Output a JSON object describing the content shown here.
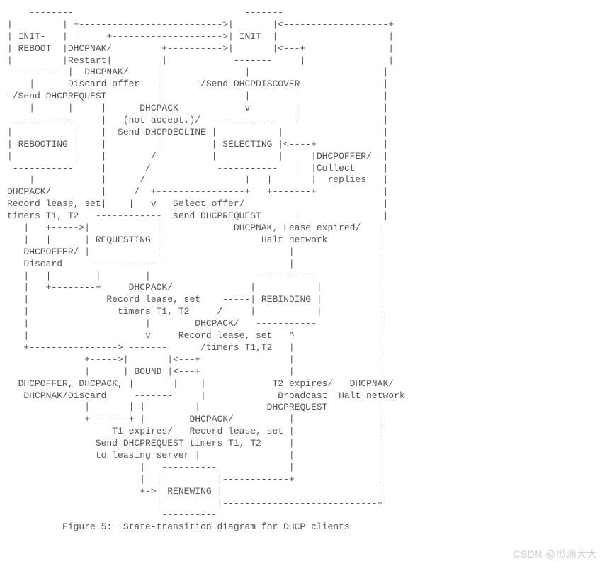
{
  "diagram": {
    "ascii": "    --------                               -------\n|         | +-------------------------->|       |<-------------------+\n| INIT-   | |     +-------------------->| INIT  |                    |\n| REBOOT  |DHCPNAK/         +---------->|       |<---+               |\n|         |Restart|         |            -------     |               |\n --------  |  DHCPNAK/     |               |                        |\n    |      Discard offer   |      -/Send DHCPDISCOVER               |\n-/Send DHCPREQUEST         |               |                        |\n    |      |     |      DHCPACK            v        |               |\n -----------     |   (not accept.)/   -----------   |               |\n|           |    |  Send DHCPDECLINE |           |                  |\n| REBOOTING |    |         |         | SELECTING |<----+            |\n|           |    |        /          |           |     |DHCPOFFER/  |\n -----------     |       /            -----------   |  |Collect     |\n    |            |      /                  |   |       |  replies   |\nDHCPACK/         |     /  +----------------+   +-------+            |\nRecord lease, set|    |   v   Select offer/                         |\ntimers T1, T2   ------------  send DHCPREQUEST      |               |\n   |   +----->|            |             DHCPNAK, Lease expired/   |\n   |   |      | REQUESTING |                  Halt network         |\n   DHCPOFFER/ |            |                       |               |\n   Discard     ------------                        |               |\n   |   |        |        |                   -----------           |\n   |   +--------+     DHCPACK/              |           |          |\n   |              Record lease, set    -----| REBINDING |          |\n   |                timers T1, T2     /     |           |          |\n   |                     |        DHCPACK/   -----------           |\n   |                     v     Record lease, set   ^               |\n   +----------------> -------      /timers T1,T2   |               |\n              +----->|       |<---+                |               |\n              |      | BOUND |<---+                |               |\n  DHCPOFFER, DHCPACK, |       |    |            T2 expires/   DHCPNAK/\n   DHCPNAK/Discard     -------     |             Broadcast  Halt network\n              |       | |         |            DHCPREQUEST         |\n              +-------+ |        DHCPACK/          |               |\n                   T1 expires/   Record lease, set |               |\n                Send DHCPREQUEST timers T1, T2     |               |\n                to leasing server |                |               |\n                        |   ----------             |               |\n                        |  |          |------------+               |\n                        +->| RENEWING |                            |\n                           |          |----------------------------+\n                            ----------\n          Figure 5:  State-transition diagram for DHCP clients",
    "caption": "Figure 5:  State-transition diagram for DHCP clients",
    "states": [
      "INIT-REBOOT",
      "INIT",
      "REBOOTING",
      "SELECTING",
      "REQUESTING",
      "REBINDING",
      "BOUND",
      "RENEWING"
    ],
    "transitions": [
      {
        "from": "INIT-REBOOT",
        "to": "REBOOTING",
        "event": "-/Send DHCPREQUEST"
      },
      {
        "from": "REBOOTING",
        "to": "INIT",
        "event": "DHCPNAK/Restart"
      },
      {
        "from": "REBOOTING",
        "to": "INIT",
        "event": "DHCPNAK/Discard offer"
      },
      {
        "from": "REBOOTING",
        "to": "BOUND",
        "event": "DHCPACK/Record lease, set timers T1, T2"
      },
      {
        "from": "INIT",
        "to": "SELECTING",
        "event": "-/Send DHCPDISCOVER"
      },
      {
        "from": "SELECTING",
        "to": "SELECTING",
        "event": "DHCPOFFER/Collect replies"
      },
      {
        "from": "SELECTING",
        "to": "REQUESTING",
        "event": "Select offer/send DHCPREQUEST"
      },
      {
        "from": "REQUESTING",
        "to": "INIT",
        "event": "DHCPACK (not accept.)/Send DHCPDECLINE"
      },
      {
        "from": "REQUESTING",
        "to": "INIT",
        "event": "DHCPNAK, Lease expired/Halt network"
      },
      {
        "from": "REQUESTING",
        "to": "REQUESTING",
        "event": "DHCPOFFER/Discard"
      },
      {
        "from": "REQUESTING",
        "to": "BOUND",
        "event": "DHCPACK/Record lease, set timers T1, T2"
      },
      {
        "from": "BOUND",
        "to": "BOUND",
        "event": "DHCPOFFER, DHCPACK, DHCPNAK/Discard"
      },
      {
        "from": "BOUND",
        "to": "RENEWING",
        "event": "T1 expires/Send DHCPREQUEST to leasing server"
      },
      {
        "from": "RENEWING",
        "to": "BOUND",
        "event": "DHCPACK/Record lease, set timers T1, T2"
      },
      {
        "from": "RENEWING",
        "to": "REBINDING",
        "event": "T2 expires/Broadcast DHCPREQUEST"
      },
      {
        "from": "RENEWING",
        "to": "INIT",
        "event": "DHCPNAK/Halt network"
      },
      {
        "from": "REBINDING",
        "to": "BOUND",
        "event": "DHCPACK/Record lease, set timers T1,T2"
      },
      {
        "from": "REBINDING",
        "to": "INIT",
        "event": "DHCPNAK/Halt network"
      }
    ]
  },
  "watermark": "CSDN @瓜洲大大"
}
